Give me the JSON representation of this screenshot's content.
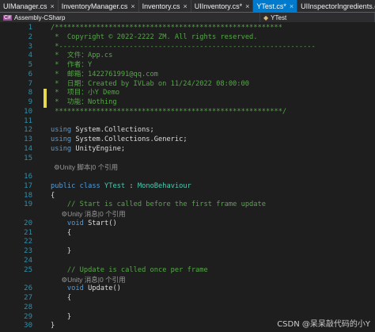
{
  "tabs": [
    {
      "label": "UIManager.cs",
      "active": false
    },
    {
      "label": "InventoryManager.cs",
      "active": false
    },
    {
      "label": "Inventory.cs",
      "active": false
    },
    {
      "label": "UIInventory.cs*",
      "active": false
    },
    {
      "label": "YTest.cs*",
      "active": true
    },
    {
      "label": "UIInspectorIngredients.cs",
      "active": false
    }
  ],
  "tab_close_glyph": "×",
  "navbar": {
    "project": "Assembly-CSharp",
    "class": "YTest",
    "cs_badge": "C#"
  },
  "lines": [
    {
      "n": "1",
      "parts": [
        {
          "t": "/*******************************************************",
          "c": "cm"
        }
      ]
    },
    {
      "n": "2",
      "parts": [
        {
          "t": " *  Copyright © 2022-2222 ZM. All rights reserved.",
          "c": "cm"
        }
      ]
    },
    {
      "n": "3",
      "parts": [
        {
          "t": " *--------------------------------------------------------------",
          "c": "cm"
        }
      ]
    },
    {
      "n": "4",
      "parts": [
        {
          "t": " *  文件：App.cs",
          "c": "cm"
        }
      ]
    },
    {
      "n": "5",
      "parts": [
        {
          "t": " *  作者：Y",
          "c": "cm"
        }
      ]
    },
    {
      "n": "6",
      "parts": [
        {
          "t": " *  邮箱：1422761991@qq.com",
          "c": "cm"
        }
      ]
    },
    {
      "n": "7",
      "parts": [
        {
          "t": " *  日期：Created by IVLab on 11/24/2022 08:00:00",
          "c": "cm"
        }
      ]
    },
    {
      "n": "8",
      "parts": [
        {
          "t": " *  项目：小Y Demo",
          "c": "cm"
        }
      ]
    },
    {
      "n": "9",
      "parts": [
        {
          "t": " *  功能：Nothing",
          "c": "cm"
        }
      ]
    },
    {
      "n": "10",
      "parts": [
        {
          "t": " *******************************************************/",
          "c": "cm"
        }
      ]
    },
    {
      "n": "11",
      "parts": []
    },
    {
      "n": "12",
      "parts": [
        {
          "t": "using",
          "c": "kw"
        },
        {
          "t": " System.Collections;",
          "c": "pl"
        }
      ]
    },
    {
      "n": "13",
      "parts": [
        {
          "t": "using",
          "c": "kw"
        },
        {
          "t": " System.Collections.Generic;",
          "c": "pl"
        }
      ]
    },
    {
      "n": "14",
      "parts": [
        {
          "t": "using",
          "c": "kw"
        },
        {
          "t": " UnityEngine;",
          "c": "pl"
        }
      ]
    },
    {
      "n": "15",
      "parts": []
    },
    {
      "lens": "⚙Unity 脚本|0 个引用"
    },
    {
      "n": "16",
      "parts": []
    },
    {
      "n": "17",
      "parts": [
        {
          "t": "public",
          "c": "kw"
        },
        {
          "t": " ",
          "c": "pl"
        },
        {
          "t": "class",
          "c": "kw"
        },
        {
          "t": " ",
          "c": "pl"
        },
        {
          "t": "YTest",
          "c": "ty"
        },
        {
          "t": " : ",
          "c": "pl"
        },
        {
          "t": "MonoBehaviour",
          "c": "ty"
        }
      ]
    },
    {
      "n": "18",
      "parts": [
        {
          "t": "{",
          "c": "pl"
        }
      ]
    },
    {
      "n": "19",
      "parts": [
        {
          "t": "    // Start is called before the first frame update",
          "c": "cm"
        }
      ]
    },
    {
      "lens": "    ⚙Unity 消息|0 个引用"
    },
    {
      "n": "20",
      "parts": [
        {
          "t": "    ",
          "c": "pl"
        },
        {
          "t": "void",
          "c": "kw"
        },
        {
          "t": " Start()",
          "c": "pl"
        }
      ]
    },
    {
      "n": "21",
      "parts": [
        {
          "t": "    {",
          "c": "pl"
        }
      ]
    },
    {
      "n": "22",
      "parts": []
    },
    {
      "n": "23",
      "parts": [
        {
          "t": "    }",
          "c": "pl"
        }
      ]
    },
    {
      "n": "24",
      "parts": []
    },
    {
      "n": "25",
      "parts": [
        {
          "t": "    // Update is called once per frame",
          "c": "cm"
        }
      ]
    },
    {
      "lens": "    ⚙Unity 消息|0 个引用"
    },
    {
      "n": "26",
      "parts": [
        {
          "t": "    ",
          "c": "pl"
        },
        {
          "t": "void",
          "c": "kw"
        },
        {
          "t": " Update()",
          "c": "pl"
        }
      ]
    },
    {
      "n": "27",
      "parts": [
        {
          "t": "    {",
          "c": "pl"
        }
      ]
    },
    {
      "n": "28",
      "parts": []
    },
    {
      "n": "29",
      "parts": [
        {
          "t": "    }",
          "c": "pl"
        }
      ]
    },
    {
      "n": "30",
      "parts": [
        {
          "t": "}",
          "c": "pl"
        }
      ]
    }
  ],
  "modified_lines": [
    "1",
    "2",
    "3",
    "4",
    "5",
    "6",
    "7",
    "8",
    "9",
    "10"
  ],
  "changed_lines": [
    "8",
    "9"
  ],
  "watermark": "CSDN @呆呆敲代码的小Y",
  "colors": {
    "comment": "#57a64a",
    "keyword": "#569cd6",
    "type": "#4ec9b0",
    "linenum": "#2b91af",
    "accent": "#007acc"
  }
}
